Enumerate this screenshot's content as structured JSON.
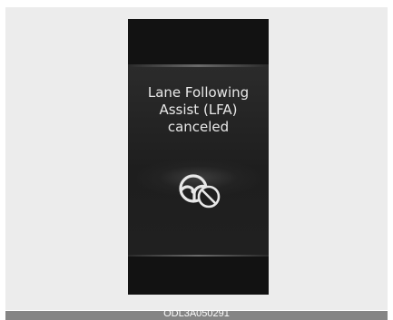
{
  "display": {
    "message_line1": "Lane Following",
    "message_line2": "Assist (LFA)",
    "message_line3": "canceled",
    "icon": "steering-wheel-cancel-icon"
  },
  "caption": "ODL3A050291",
  "colors": {
    "screen": "#151515",
    "text": "#e8e8e8",
    "background": "#ececec",
    "caption_bar": "#858585"
  }
}
